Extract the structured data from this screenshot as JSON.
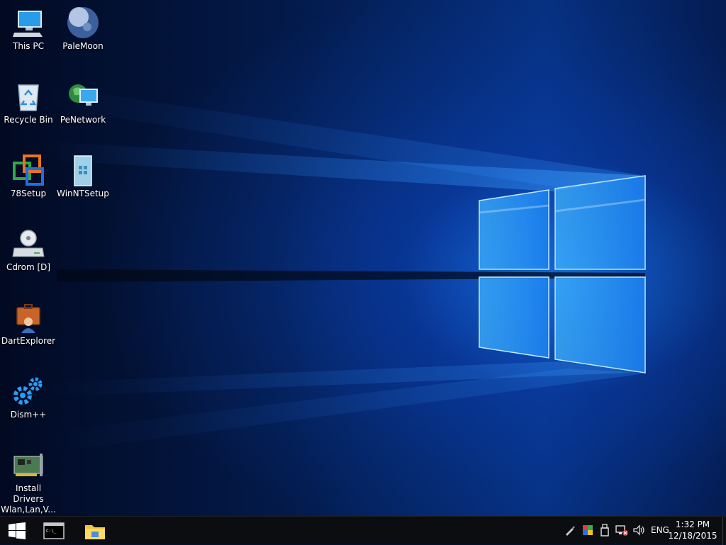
{
  "desktop_icons": [
    {
      "label": "This PC",
      "icon": "computer-icon"
    },
    {
      "label": "PaleMoon",
      "icon": "palemoon-browser-icon"
    },
    {
      "label": "Recycle Bin",
      "icon": "recycle-bin-icon"
    },
    {
      "label": "PeNetwork",
      "icon": "network-globe-icon"
    },
    {
      "label": "78Setup",
      "icon": "setup-windows-icon"
    },
    {
      "label": "WinNTSetup",
      "icon": "winntsetup-icon"
    },
    {
      "label": "Cdrom [D]",
      "icon": "cd-drive-icon"
    },
    {
      "label": "DartExplorer",
      "icon": "toolbox-user-icon"
    },
    {
      "label": "Dism++",
      "icon": "gears-icon"
    },
    {
      "label": "Install Drivers\nWlan,Lan,V...",
      "icon": "network-card-icon"
    }
  ],
  "taskbar": {
    "start": {
      "icon": "windows-logo-icon"
    },
    "pinned": [
      {
        "icon": "command-prompt-icon"
      },
      {
        "icon": "file-explorer-icon"
      }
    ],
    "tray": {
      "icons": [
        "pen-tool-icon",
        "color-palette-icon",
        "usb-drive-icon",
        "network-error-icon",
        "speaker-icon"
      ],
      "language": "ENG",
      "time": "1:32 PM",
      "date": "12/18/2015"
    }
  },
  "colors": {
    "taskbar": "#0b0d10",
    "accent": "#1e8cff",
    "background_dark": "#021130"
  }
}
